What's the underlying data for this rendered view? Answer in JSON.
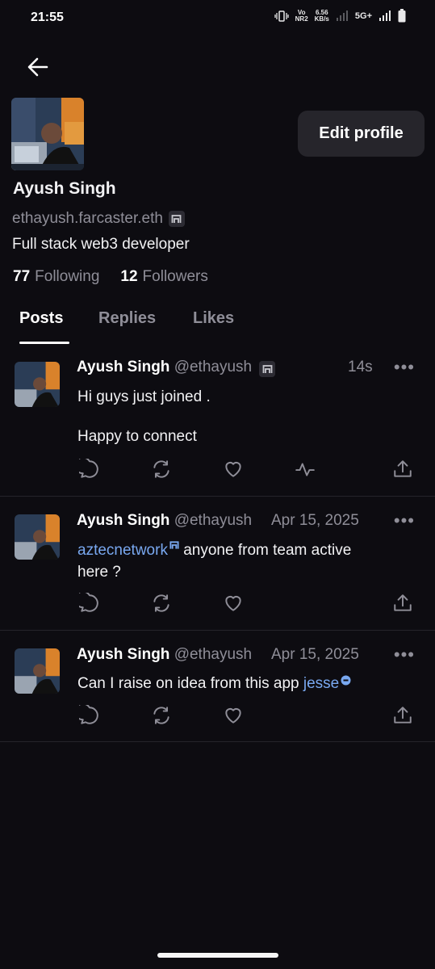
{
  "status_bar": {
    "time": "21:55",
    "vo_top": "Vo",
    "vo_bottom": "NR2",
    "speed_top": "6.56",
    "speed_bottom": "KB/s",
    "network": "5G+"
  },
  "header": {
    "edit_profile_label": "Edit profile"
  },
  "profile": {
    "display_name": "Ayush Singh",
    "fname": "ethayush.farcaster.eth",
    "bio": "Full stack web3 developer",
    "following_count": "77",
    "following_label": "Following",
    "followers_count": "12",
    "followers_label": "Followers"
  },
  "tabs": [
    {
      "label": "Posts",
      "active": true
    },
    {
      "label": "Replies",
      "active": false
    },
    {
      "label": "Likes",
      "active": false
    }
  ],
  "posts": [
    {
      "name": "Ayush Singh",
      "handle": "@ethayush",
      "time": "14s",
      "line1": "Hi guys just joined .",
      "line2": "Happy to connect"
    },
    {
      "name": "Ayush Singh",
      "handle": "@ethayush",
      "time": "Apr 15, 2025",
      "mention": "aztecnetwork",
      "text_after_mention": " anyone from team active",
      "line2": "here ?"
    },
    {
      "name": "Ayush Singh",
      "handle": "@ethayush",
      "time": "Apr 15, 2025",
      "text_before_mention": "Can I raise on idea from this app ",
      "mention": "jesse"
    }
  ],
  "colors": {
    "background": "#0d0c11",
    "link": "#79a8f0",
    "muted": "#8f8e98",
    "button_bg": "#26252b"
  }
}
